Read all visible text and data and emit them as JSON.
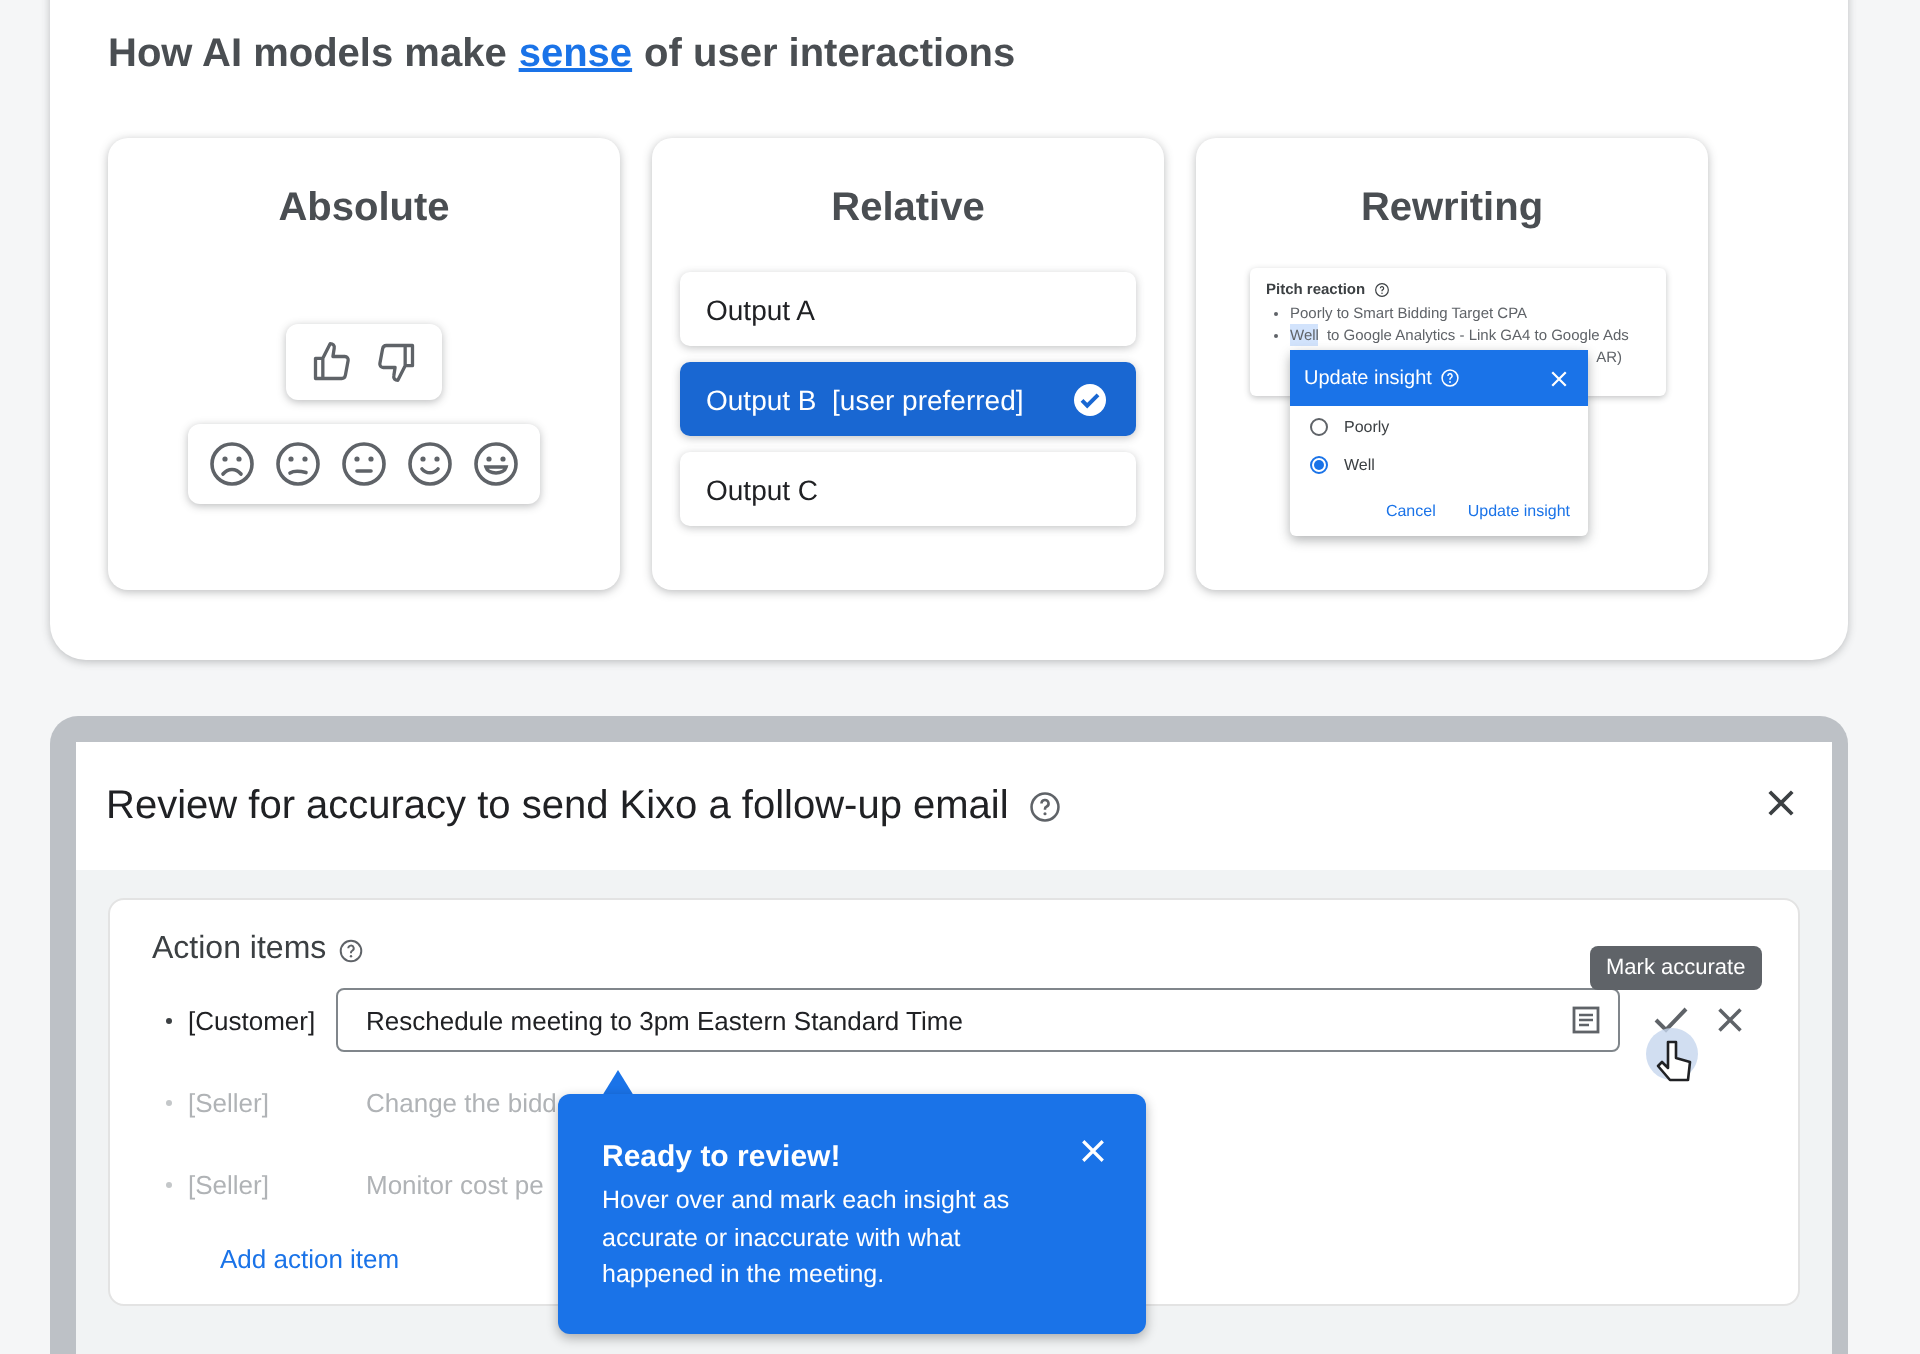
{
  "intro": {
    "title_before": "How AI models make",
    "link": "sense",
    "title_after": "of user interactions"
  },
  "cards": [
    {
      "kind": "absolute",
      "title": "Absolute"
    },
    {
      "kind": "relative",
      "title": "Relative",
      "outputs": [
        {
          "label": "Output A",
          "selected": false
        },
        {
          "label": "Output B  [user preferred]",
          "selected": true
        },
        {
          "label": "Output C",
          "selected": false
        }
      ]
    },
    {
      "kind": "rewriting",
      "title": "Rewriting",
      "document": {
        "heading": "Pitch reaction",
        "bullets": [
          {
            "kind": "plain",
            "text": "Poorly to Smart Bidding Target CPA"
          },
          {
            "kind": "highlighted",
            "highlight": "Well",
            "text": "to Google Analytics - Link GA4 to Google Ads"
          },
          {
            "kind": "covered",
            "text": "AR)"
          }
        ]
      },
      "popup": {
        "title": "Update insight",
        "options": [
          {
            "label": "Poorly",
            "selected": false
          },
          {
            "label": "Well",
            "selected": true
          }
        ],
        "buttons": [
          "Cancel",
          "Update insight"
        ]
      }
    }
  ],
  "dialog": {
    "title": "Review for accuracy to send Kixo a follow-up email",
    "section": {
      "title": "Action items",
      "rows": [
        {
          "role": "[Customer]",
          "text": "Reschedule meeting to 3pm Eastern Standard Time",
          "active": true
        },
        {
          "role": "[Seller]",
          "text": "Change the bidd",
          "active": false
        },
        {
          "role": "[Seller]",
          "text": "Monitor cost pe",
          "active": false
        }
      ],
      "add_link": "Add action item"
    },
    "tooltip": "Mark accurate",
    "coachmark": {
      "title": "Ready to review!",
      "body": "Hover over and mark each insight as accurate or inaccurate with what happened in the meeting."
    }
  }
}
